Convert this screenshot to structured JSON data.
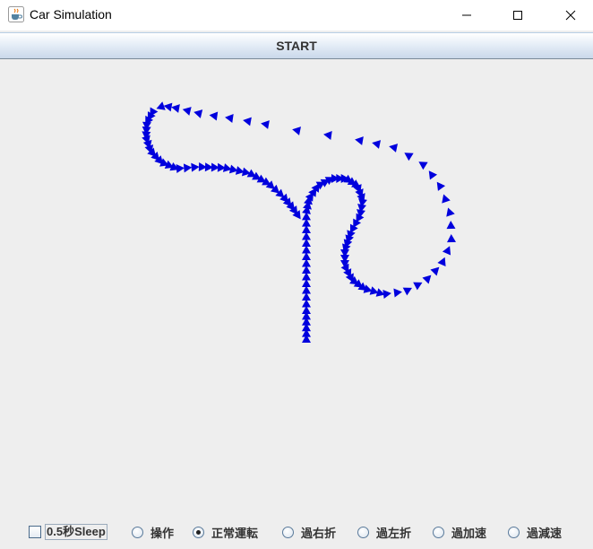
{
  "window": {
    "title": "Car Simulation",
    "app_icon": "java-cup-icon",
    "controls": [
      "minimize-icon",
      "maximize-icon",
      "close-icon"
    ]
  },
  "toolbar": {
    "start_label": "START"
  },
  "simulation": {
    "arrow_color": "#0000dd",
    "car_glyph": "triangle-arrow"
  },
  "options": {
    "sleep_label": "0.5秒Sleep",
    "sleep_checked": false,
    "modes": [
      {
        "label": "操作",
        "selected": false
      },
      {
        "label": "正常運転",
        "selected": true
      },
      {
        "label": "過右折",
        "selected": false
      },
      {
        "label": "過左折",
        "selected": false
      },
      {
        "label": "過加速",
        "selected": false
      },
      {
        "label": "過減速",
        "selected": false
      }
    ]
  }
}
